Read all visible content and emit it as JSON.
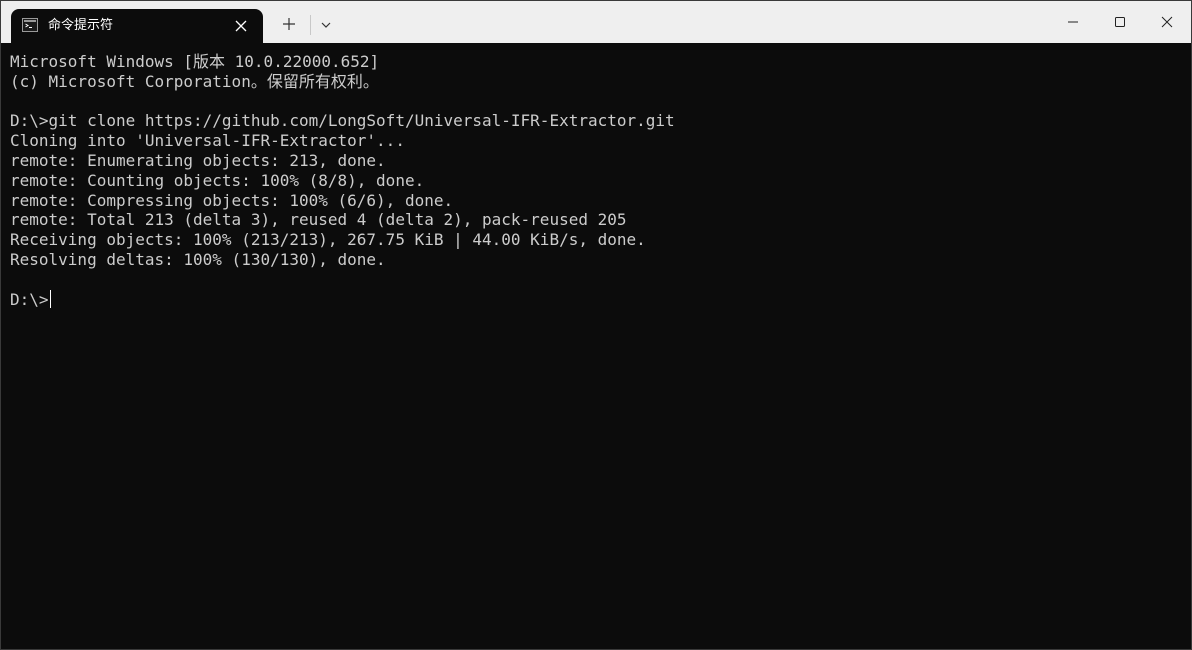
{
  "tab": {
    "title": "命令提示符",
    "icon": "command-prompt-icon"
  },
  "titlebar": {
    "new_tab_icon": "plus-icon",
    "dropdown_icon": "chevron-down-icon",
    "minimize_icon": "minimize-icon",
    "maximize_icon": "maximize-icon",
    "close_icon": "close-icon"
  },
  "terminal": {
    "lines": [
      "Microsoft Windows [版本 10.0.22000.652]",
      "(c) Microsoft Corporation。保留所有权利。",
      "",
      "D:\\>git clone https://github.com/LongSoft/Universal-IFR-Extractor.git",
      "Cloning into 'Universal-IFR-Extractor'...",
      "remote: Enumerating objects: 213, done.",
      "remote: Counting objects: 100% (8/8), done.",
      "remote: Compressing objects: 100% (6/6), done.",
      "remote: Total 213 (delta 3), reused 4 (delta 2), pack-reused 205",
      "Receiving objects: 100% (213/213), 267.75 KiB | 44.00 KiB/s, done.",
      "Resolving deltas: 100% (130/130), done.",
      ""
    ],
    "prompt": "D:\\>"
  }
}
